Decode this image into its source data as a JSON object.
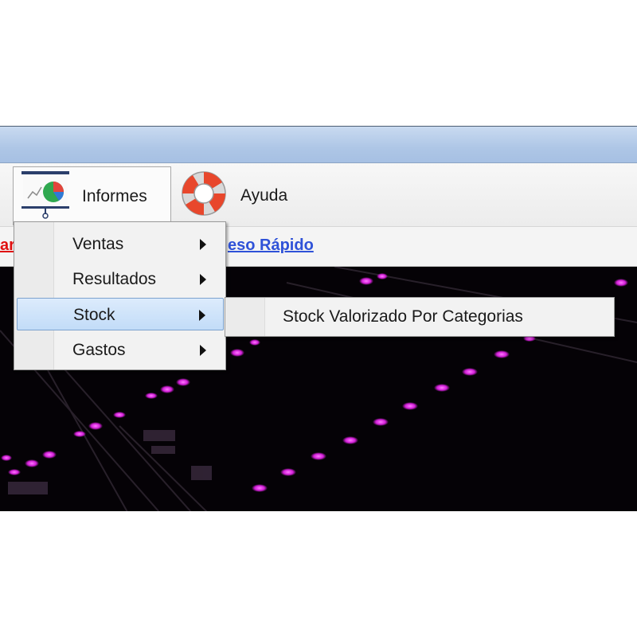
{
  "toolbar": {
    "informes_label": "Informes",
    "ayuda_label": "Ayuda"
  },
  "linkbar": {
    "red_link_text": "ar",
    "blue_link_text": "eso Rápido"
  },
  "menu": {
    "items": [
      {
        "label": "Ventas",
        "has_submenu": true,
        "active": false
      },
      {
        "label": "Resultados",
        "has_submenu": true,
        "active": false
      },
      {
        "label": "Stock",
        "has_submenu": true,
        "active": true
      },
      {
        "label": "Gastos",
        "has_submenu": true,
        "active": false
      }
    ]
  },
  "submenu": {
    "items": [
      {
        "label": "Stock Valorizado Por Categorias"
      }
    ]
  },
  "icons": {
    "informes": "presentation-chart-icon",
    "ayuda": "lifebuoy-icon"
  },
  "colors": {
    "accent_red_link": "#e01010",
    "accent_blue_link": "#2f52d8",
    "highlight": "#c2dcf8",
    "background_glow": "#d21ed7"
  }
}
